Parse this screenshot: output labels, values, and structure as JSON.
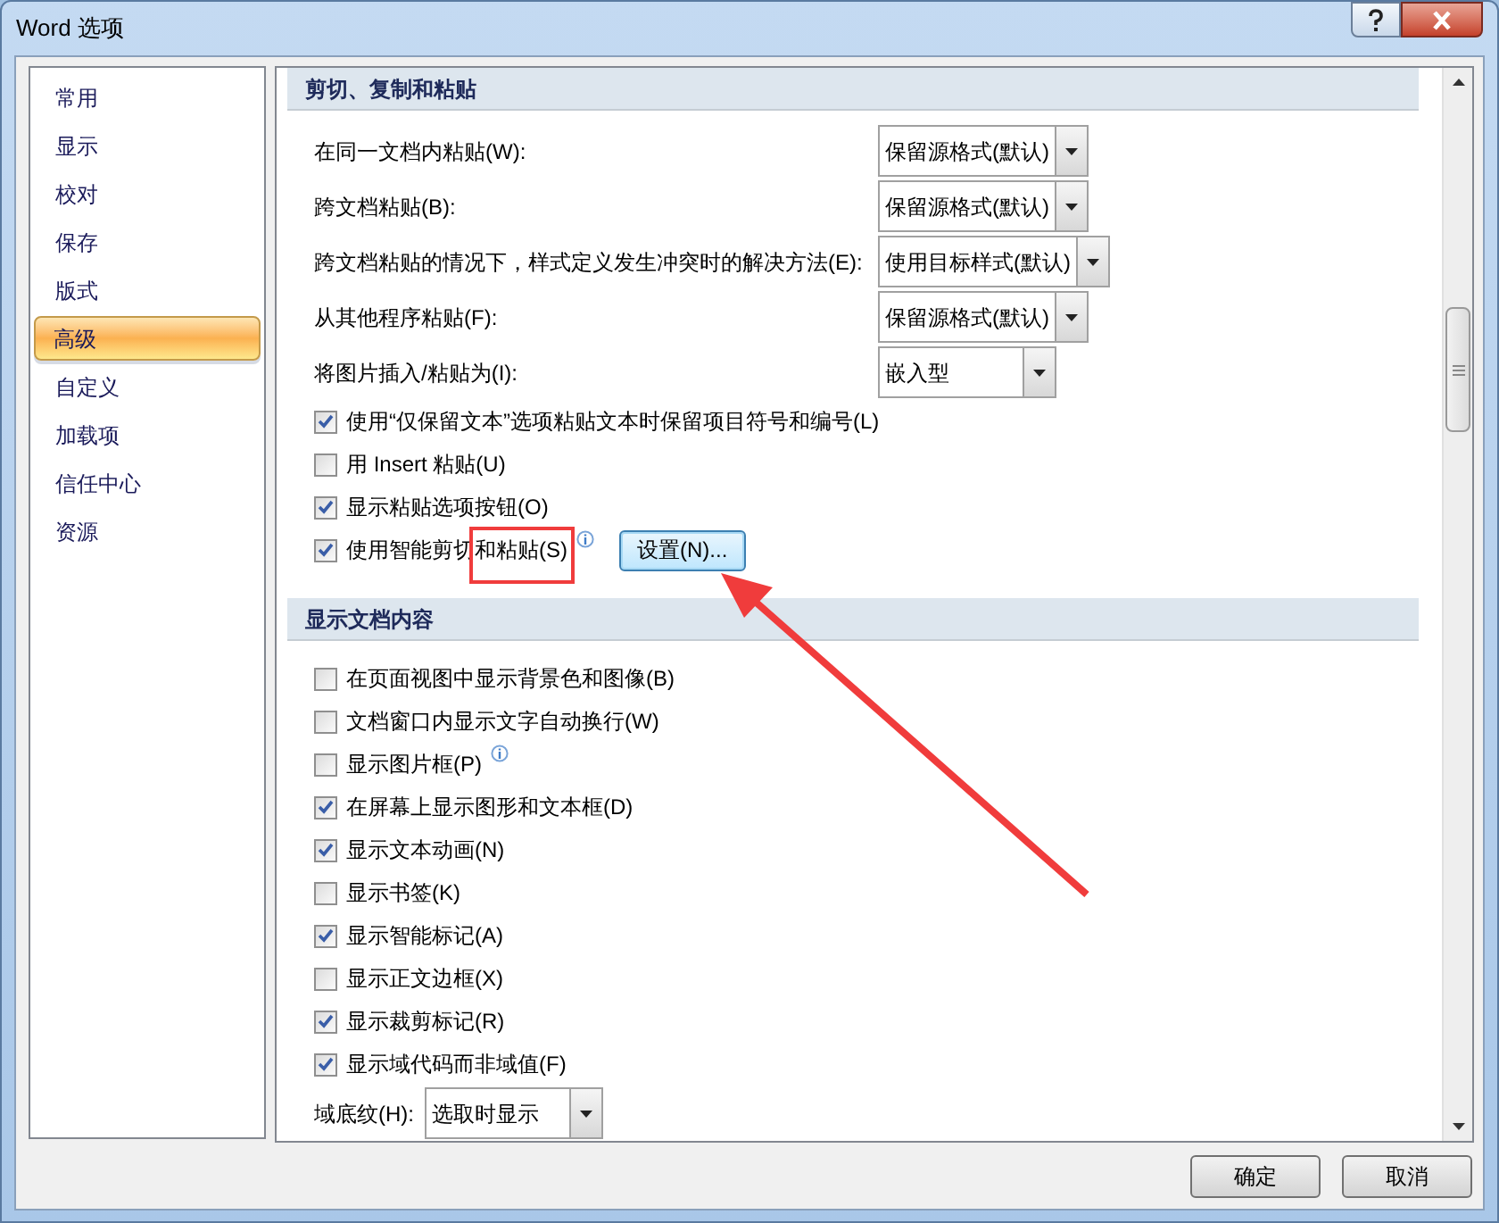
{
  "window": {
    "title": "Word 选项"
  },
  "sidebar": {
    "items": [
      {
        "label": "常用",
        "selected": false
      },
      {
        "label": "显示",
        "selected": false
      },
      {
        "label": "校对",
        "selected": false
      },
      {
        "label": "保存",
        "selected": false
      },
      {
        "label": "版式",
        "selected": false
      },
      {
        "label": "高级",
        "selected": true
      },
      {
        "label": "自定义",
        "selected": false
      },
      {
        "label": "加载项",
        "selected": false
      },
      {
        "label": "信任中心",
        "selected": false
      },
      {
        "label": "资源",
        "selected": false
      }
    ]
  },
  "sections": [
    {
      "title": "剪切、复制和粘贴",
      "items": [
        {
          "kind": "dropdown",
          "label": "在同一文档内粘贴(W):",
          "value": "保留源格式(默认)"
        },
        {
          "kind": "dropdown",
          "label": "跨文档粘贴(B):",
          "value": "保留源格式(默认)"
        },
        {
          "kind": "dropdown",
          "label": "跨文档粘贴的情况下，样式定义发生冲突时的解决方法(E):",
          "value": "使用目标样式(默认)"
        },
        {
          "kind": "dropdown",
          "label": "从其他程序粘贴(F):",
          "value": "保留源格式(默认)"
        },
        {
          "kind": "dropdown",
          "label": "将图片插入/粘贴为(I):",
          "value": "嵌入型"
        },
        {
          "kind": "checkbox",
          "label": "使用“仅保留文本”选项粘贴文本时保留项目符号和编号(L)",
          "checked": true,
          "info": false
        },
        {
          "kind": "checkbox",
          "label": "用 Insert 粘贴(U)",
          "checked": false,
          "info": false
        },
        {
          "kind": "checkbox",
          "label": "显示粘贴选项按钮(O)",
          "checked": true,
          "info": false
        },
        {
          "kind": "checkbox",
          "label": "使用智能剪切和粘贴(S)",
          "checked": true,
          "info": true,
          "button": "设置(N)..."
        }
      ]
    },
    {
      "title": "显示文档内容",
      "items": [
        {
          "kind": "checkbox",
          "label": "在页面视图中显示背景色和图像(B)",
          "checked": false,
          "info": false
        },
        {
          "kind": "checkbox",
          "label": "文档窗口内显示文字自动换行(W)",
          "checked": false,
          "info": false
        },
        {
          "kind": "checkbox",
          "label": "显示图片框(P)",
          "checked": false,
          "info": true
        },
        {
          "kind": "checkbox",
          "label": "在屏幕上显示图形和文本框(D)",
          "checked": true,
          "info": false
        },
        {
          "kind": "checkbox",
          "label": "显示文本动画(N)",
          "checked": true,
          "info": false
        },
        {
          "kind": "checkbox",
          "label": "显示书签(K)",
          "checked": false,
          "info": false
        },
        {
          "kind": "checkbox",
          "label": "显示智能标记(A)",
          "checked": true,
          "info": false
        },
        {
          "kind": "checkbox",
          "label": "显示正文边框(X)",
          "checked": false,
          "info": false
        },
        {
          "kind": "checkbox",
          "label": "显示裁剪标记(R)",
          "checked": true,
          "info": false
        },
        {
          "kind": "checkbox",
          "label": "显示域代码而非域值(F)",
          "checked": true,
          "info": false
        },
        {
          "kind": "short-dropdown",
          "label": "域底纹(H):",
          "value": "选取时显示"
        }
      ]
    }
  ],
  "buttons": [
    "确定",
    "取消"
  ],
  "annotations": {
    "highlight_box": true,
    "arrow": true
  }
}
